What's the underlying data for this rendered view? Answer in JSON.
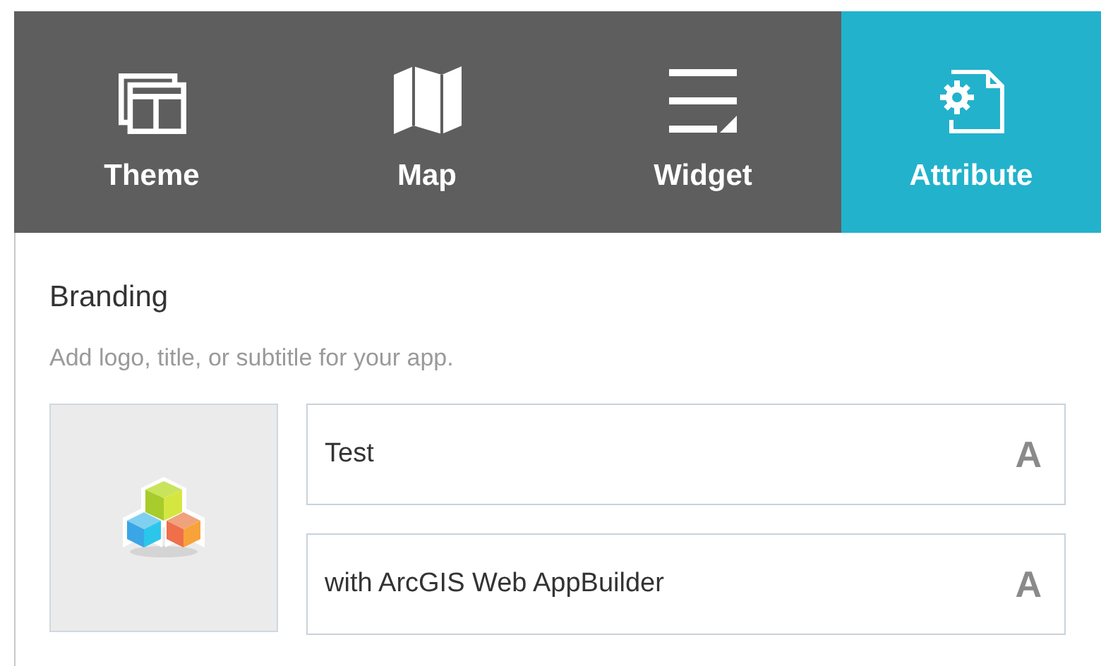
{
  "tabs": [
    {
      "label": "Theme",
      "selected": false
    },
    {
      "label": "Map",
      "selected": false
    },
    {
      "label": "Widget",
      "selected": false
    },
    {
      "label": "Attribute",
      "selected": true
    }
  ],
  "branding": {
    "title": "Branding",
    "description": "Add logo, title, or subtitle for your app.",
    "fields": [
      {
        "value": "Test",
        "style_button": "A"
      },
      {
        "value": "with ArcGIS Web AppBuilder",
        "style_button": "A"
      }
    ]
  }
}
